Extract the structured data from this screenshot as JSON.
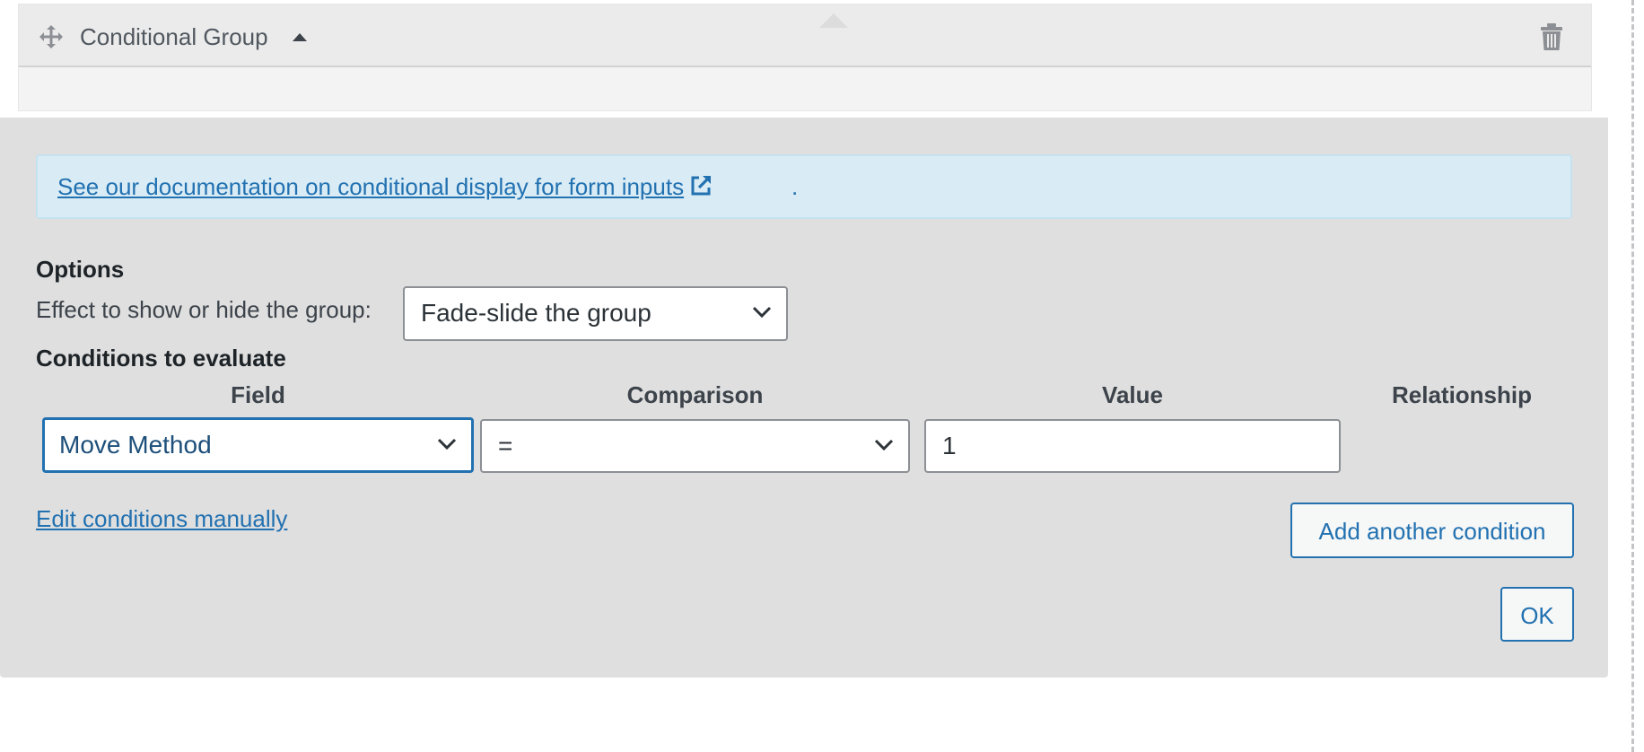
{
  "group": {
    "title": "Conditional Group",
    "icons": [
      "move-icon",
      "caret-up-icon",
      "trash-icon"
    ]
  },
  "notice": {
    "link_text": "See our documentation on conditional display for form inputs",
    "suffix": ".",
    "icon": "external-link-icon"
  },
  "options": {
    "heading": "Options",
    "effect_label": "Effect to show or hide the group:",
    "effect_value": "Fade-slide the group"
  },
  "conditions": {
    "heading": "Conditions to evaluate",
    "columns": [
      "Field",
      "Comparison",
      "Value",
      "Relationship"
    ],
    "rows": [
      {
        "field": "Move Method",
        "comparison": "=",
        "value": "1"
      }
    ]
  },
  "actions": {
    "edit_manually": "Edit conditions manually",
    "add_condition": "Add another condition",
    "ok": "OK"
  },
  "colors": {
    "accent": "#2271b1",
    "panel_bg": "#dfdfdf",
    "notice_bg": "#d9ecf5"
  }
}
